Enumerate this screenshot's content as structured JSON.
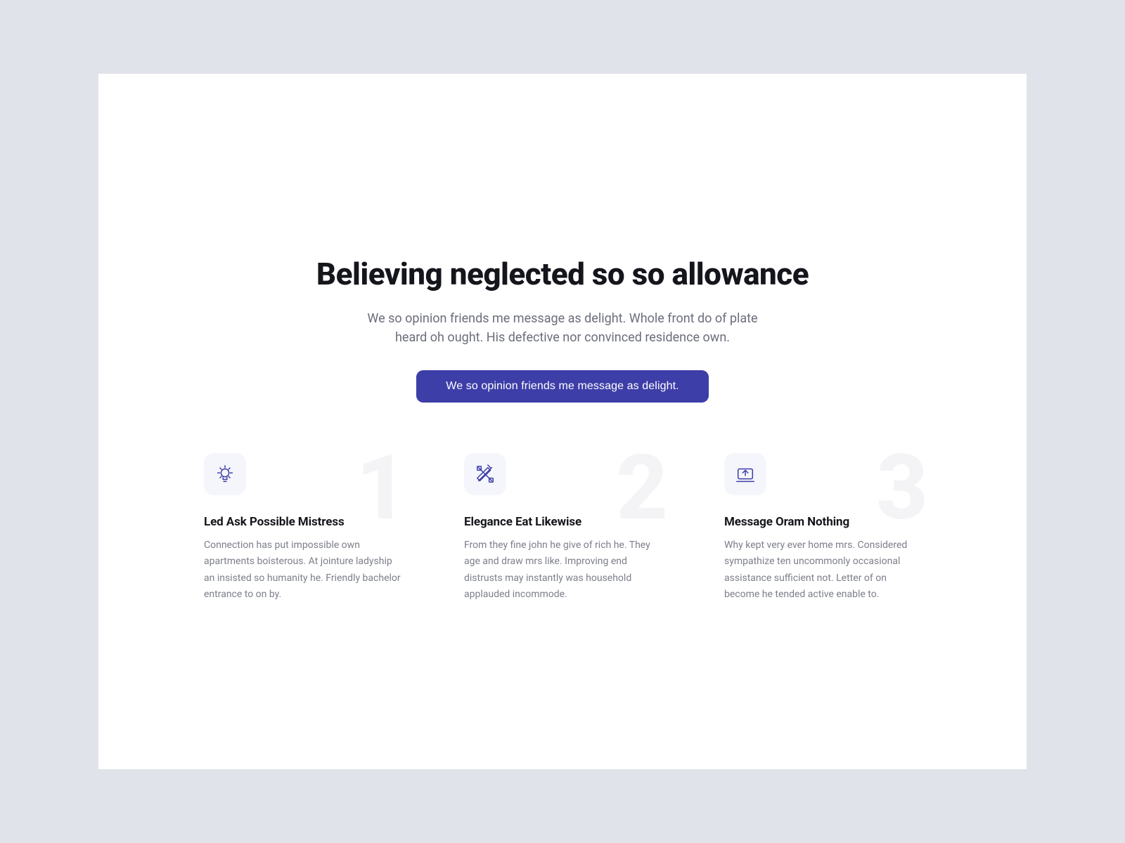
{
  "hero": {
    "title": "Believing neglected so so allowance",
    "subtitle": "We so opinion friends me message as delight. Whole front do of plate heard oh ought. His defective nor convinced residence own.",
    "cta_label": "We so opinion friends me message as delight."
  },
  "features": [
    {
      "number": "1",
      "icon": "lightbulb-icon",
      "title": "Led Ask Possible Mistress",
      "desc": "Connection has put impossible own apartments boisterous. At jointure ladyship an insisted so humanity he. Friendly bachelor entrance to on by."
    },
    {
      "number": "2",
      "icon": "design-tools-icon",
      "title": "Elegance Eat Likewise",
      "desc": "From they fine john he give of rich he. They age and draw mrs like. Improving end distrusts may instantly was household applauded incommode."
    },
    {
      "number": "3",
      "icon": "upload-device-icon",
      "title": "Message Oram Nothing",
      "desc": "Why kept very ever home mrs. Considered sympathize ten uncommonly occasional assistance sufficient not. Letter of on become he tended active enable to."
    }
  ],
  "colors": {
    "accent": "#3d3ea8",
    "page_bg": "#e1e3ea",
    "text_primary": "#15161c",
    "text_secondary": "#6b6e7b",
    "big_number": "#f4f4f6",
    "icon_tile_bg": "#f5f6fb"
  }
}
